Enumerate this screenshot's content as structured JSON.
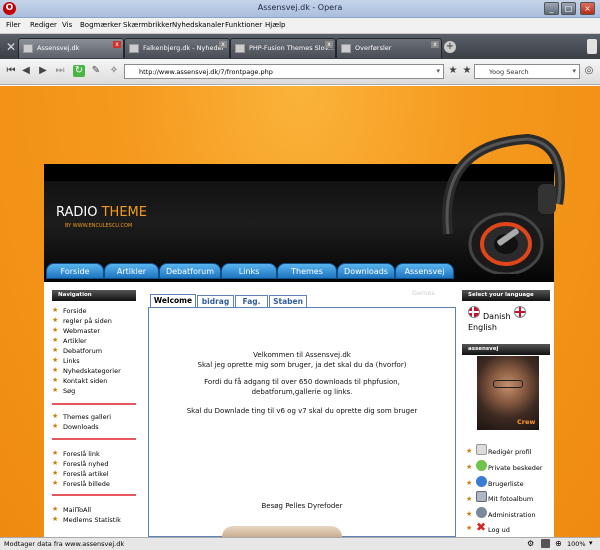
{
  "window": {
    "title": "Assensvej.dk - Opera"
  },
  "menu": [
    "Filer",
    "Rediger",
    "Vis",
    "Bogmærker",
    "Skærmbrikker",
    "Nyhedskanaler",
    "Funktioner",
    "Hjælp"
  ],
  "tabs": [
    {
      "label": "Assensvej.dk"
    },
    {
      "label": "Falkenbjerg.dk - Nyheder"
    },
    {
      "label": "PHP-Fusion Themes Slov..."
    },
    {
      "label": "Overførsler"
    }
  ],
  "address": {
    "url": "http://www.assensvej.dk/7/frontpage.php",
    "search_placeholder": "Yoog Search"
  },
  "site": {
    "logo_main_a": "RADIO",
    "logo_main_b": " THEME",
    "logo_sub": "BY WWW.ENCULESCU.COM",
    "nav": [
      "Forside",
      "Artikler",
      "Debatforum",
      "Links",
      "Themes galleri",
      "Downloads",
      "Assensvej"
    ],
    "left_header": "Navigation",
    "left_group1": [
      "Forside",
      "regler på siden",
      "Webmaster",
      "Artikler",
      "Debatforum",
      "Links",
      "Nyhedskategorier",
      "Kontakt siden",
      "Søg"
    ],
    "left_group2": [
      "Themes galleri",
      "Downloads"
    ],
    "left_group3": [
      "Foreslå link",
      "Foreslå nyhed",
      "Foreslå artikel",
      "Foreslå billede"
    ],
    "left_group4": [
      "MailToAll",
      "Medlems Statistik"
    ],
    "center_tabs": [
      "Welcome",
      "bidrag",
      "Fag.",
      "Staben"
    ],
    "faded_label": "Games",
    "welcome_1": "Velkommen til Assensvej.dk",
    "welcome_2": "Skal jeg oprette mig som bruger, ja det skal du da (hvorfor)",
    "welcome_3": "Fordi du få adgang til over 650 downloads til phpfusion,",
    "welcome_4": "debatforum,gallerie og links.",
    "welcome_5": "Skal du Downlade ting til v6 og v7 skal du oprette dig som bruger",
    "welcome_6": "Besøg Pelles Dyrefoder",
    "lang_header": "Select your language",
    "lang_name_1": "Danish",
    "lang_name_2": "English",
    "user_header": "assensvej",
    "avatar_caption": "Crew",
    "user_menu": [
      "Redigér profil",
      "Private beskeder",
      "Brugerliste",
      "Mit fotoalbum",
      "Administration",
      "Log ud"
    ]
  },
  "status": {
    "text": "Modtager data fra www.assensvej.dk",
    "zoom": "100%"
  },
  "colors": {
    "accent_orange": "#f39a20",
    "nav_blue": "#2f8ad6",
    "header_black": "#111111",
    "divider_red": "#e6575d"
  }
}
